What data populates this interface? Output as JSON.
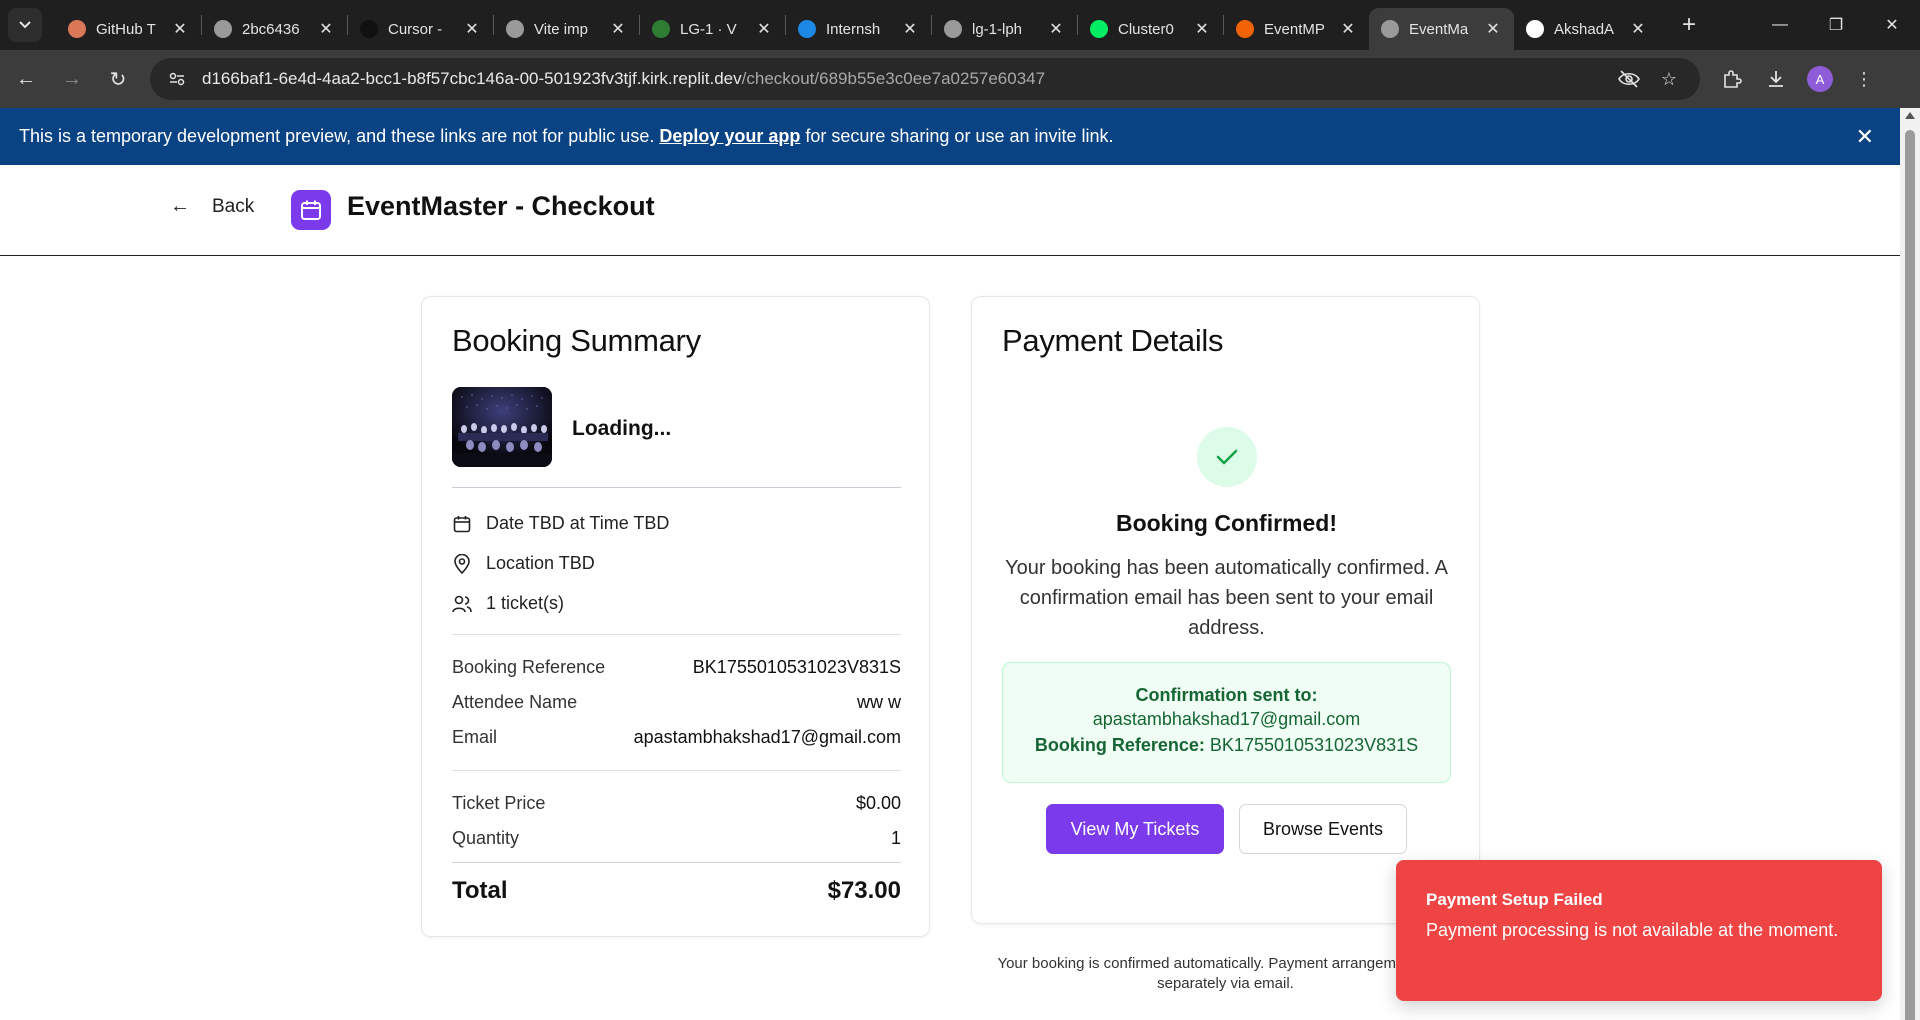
{
  "browser": {
    "tabs": [
      {
        "title": "GitHub T",
        "favicon": "claude-icon",
        "color": "#d97757"
      },
      {
        "title": "2bc6436",
        "favicon": "openai-icon",
        "color": "#9a9a9a"
      },
      {
        "title": "Cursor -",
        "favicon": "cursor-icon",
        "color": "#111111"
      },
      {
        "title": "Vite imp",
        "favicon": "openai-icon",
        "color": "#9a9a9a"
      },
      {
        "title": "LG-1 · V",
        "favicon": "vercel-check-icon",
        "color": "#2e7d32"
      },
      {
        "title": "Internsh",
        "favicon": "is-icon",
        "color": "#1e88e5"
      },
      {
        "title": "lg-1-lph",
        "favicon": "globe-icon",
        "color": "#9a9a9a"
      },
      {
        "title": "Cluster0",
        "favicon": "mongodb-leaf-icon",
        "color": "#00ed64"
      },
      {
        "title": "EventMP",
        "favicon": "replit-icon",
        "color": "#f26207"
      },
      {
        "title": "EventMa",
        "favicon": "globe-icon",
        "color": "#9a9a9a",
        "active": true
      },
      {
        "title": "AkshadA",
        "favicon": "github-icon",
        "color": "#ffffff"
      }
    ],
    "url_host": "d166baf1-6e4d-4aa2-bcc1-b8f57cbc146a-00-501923fv3tjf.kirk.replit.dev",
    "url_path": "/checkout/689b55e3c0ee7a0257e60347",
    "profile_initial": "A"
  },
  "banner": {
    "text_before": "This is a temporary development preview, and these links are not for public use.",
    "link": "Deploy your app",
    "text_after": "for secure sharing or use an invite link."
  },
  "header": {
    "back_label": "Back",
    "title": "EventMaster - Checkout"
  },
  "booking_summary": {
    "heading": "Booking Summary",
    "event_name": "Loading...",
    "date_time": "Date TBD at Time TBD",
    "location": "Location TBD",
    "tickets": "1 ticket(s)",
    "reference_label": "Booking Reference",
    "reference_value": "BK1755010531023V831S",
    "attendee_label": "Attendee Name",
    "attendee_value": "ww w",
    "email_label": "Email",
    "email_value": "apastambhakshad17@gmail.com",
    "price_label": "Ticket Price",
    "price_value": "$0.00",
    "quantity_label": "Quantity",
    "quantity_value": "1",
    "total_label": "Total",
    "total_value": "$73.00"
  },
  "payment": {
    "heading": "Payment Details",
    "confirmed_title": "Booking Confirmed!",
    "confirmed_text": "Your booking has been automatically confirmed. A confirmation email has been sent to your email address.",
    "sent_to_label": "Confirmation sent to:",
    "sent_to_email": "apastambhakshad17@gmail.com",
    "ref_label": "Booking Reference:",
    "ref_value": "BK1755010531023V831S",
    "view_tickets": "View My Tickets",
    "browse_events": "Browse Events"
  },
  "footnote": "Your booking is confirmed automatically. Payment arrangem handled separately via email.",
  "toast": {
    "title": "Payment Setup Failed",
    "description": "Payment processing is not available at the moment."
  },
  "colors": {
    "accent": "#7c3aed",
    "banner": "#0a4384",
    "success": "#166534",
    "error": "#ef4444"
  }
}
